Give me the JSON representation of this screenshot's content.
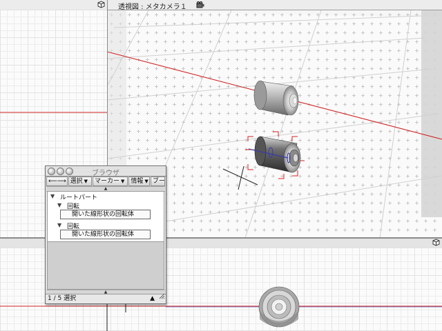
{
  "perspective_view": {
    "title": "透視図 : メタカメラ１",
    "camera_icon": "camera-icon",
    "menu_icon": "cube-icon",
    "hidden_label_fragment": "1"
  },
  "left_view": {
    "menu_icon": "cube-icon"
  },
  "bottom_view": {
    "menu_icon": "cube-icon"
  },
  "browser": {
    "title": "ブラウザ",
    "toolbar": {
      "nav_label": "⟵⟶",
      "select_label": "選択",
      "marker_label": "マーカー",
      "info_label": "情報",
      "extra_label": "ブー"
    },
    "tree": {
      "root": "ルートパート",
      "groups": [
        {
          "label": "回転",
          "child": "開いた線形状の回転体"
        },
        {
          "label": "回転",
          "child": "開いた線形状の回転体"
        }
      ]
    },
    "status": "1 / 5 選択"
  },
  "colors": {
    "x_axis": "#d02020",
    "y_axis": "#3a3aa8",
    "selection": "#e02020",
    "window_bg": "#e8e8e8"
  }
}
